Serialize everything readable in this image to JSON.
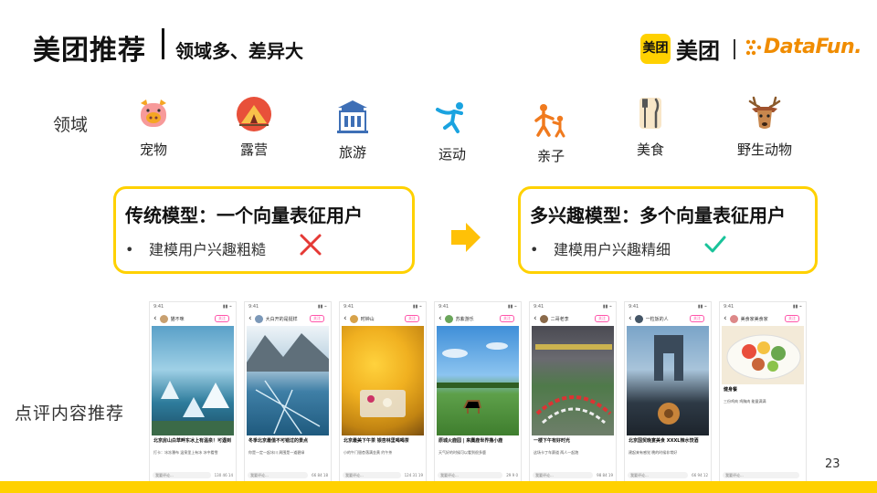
{
  "header": {
    "title": "美团推荐",
    "subtitle": "领域多、差异大",
    "logo_box_text": "美团",
    "logo_text": "美团",
    "datafun_text": "DataFun."
  },
  "domains": {
    "label": "领域",
    "items": [
      {
        "label": "宠物",
        "icon": "pet-pig-icon"
      },
      {
        "label": "露营",
        "icon": "camping-tent-icon"
      },
      {
        "label": "旅游",
        "icon": "travel-building-icon"
      },
      {
        "label": "运动",
        "icon": "sport-person-icon"
      },
      {
        "label": "亲子",
        "icon": "parent-child-icon"
      },
      {
        "label": "美食",
        "icon": "food-utensils-icon"
      },
      {
        "label": "野生动物",
        "icon": "wildlife-deer-icon"
      }
    ]
  },
  "models": {
    "traditional": {
      "title": "传统模型：一个向量表征用户",
      "bullet": "建模用户兴趣粗糙",
      "result": "cross-icon"
    },
    "multi": {
      "title": "多兴趣模型：多个向量表征用户",
      "bullet": "建模用户兴趣精细",
      "result": "check-icon"
    }
  },
  "recommendation": {
    "label": "点评内容推荐",
    "posts": [
      {
        "author": "猫不咪",
        "caption": "北京房山白草畔东冰上有温泉！可遇到",
        "body": "打卡：冰冻瀑布 温泉里上有冰 冰中看雪",
        "likes": "130",
        "stars": "46",
        "comments": "14"
      },
      {
        "author": "大白开的是挺样",
        "caption": "冬季北京最值不可错过的景点",
        "body": "你是一定一起冰川 周围是一道碧绿",
        "likes": "66",
        "stars": "84",
        "comments": "18"
      },
      {
        "author": "时钟山",
        "caption": "北京最美下午茶 银杏林里喝喝茶",
        "body": "小的午门银杏落满金黄 约午茶",
        "likes": "124",
        "stars": "31",
        "comments": "19"
      },
      {
        "author": "苏紫游乐",
        "caption": "原城火鹿园 | 来麋鹿世界撸小鹿",
        "body": "天气好的时候可以看到很多鹿",
        "likes": "29",
        "stars": "9",
        "comments": "0"
      },
      {
        "author": "二哥老李",
        "caption": "一楼下午有好时光",
        "body": "这场卡丁车赛道 两人一起跑",
        "likes": "98",
        "stars": "84",
        "comments": "19"
      },
      {
        "author": "一粒饭的人",
        "caption": "北京国贸晚宴美食 XXXL辣水饺酒",
        "body": "建起来有感觉 晚的时候非常好",
        "likes": "66",
        "stars": "94",
        "comments": "12"
      },
      {
        "author": "美食家美食家",
        "caption": "健身餐",
        "body": "三份鸡肉 鸡胸肉 能量满满",
        "likes": "",
        "stars": "",
        "comments": ""
      }
    ],
    "comment_placeholder": "我要评论..."
  },
  "page_number": "23",
  "colors": {
    "accent": "#FFD100",
    "orange": "#F08C00",
    "cross": "#E53935",
    "check": "#19C39A"
  }
}
